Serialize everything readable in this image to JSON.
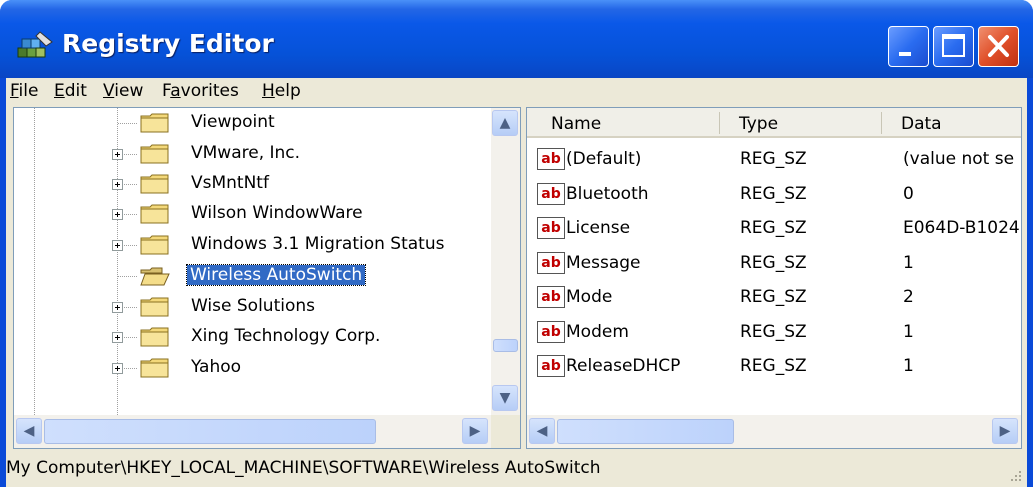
{
  "window": {
    "title": "Registry Editor",
    "title_color": "#ffffff",
    "titlebar_color": "#0a58e8"
  },
  "menu": [
    {
      "accel": "F",
      "rest": "ile"
    },
    {
      "accel": "E",
      "rest": "dit"
    },
    {
      "accel": "V",
      "rest": "iew"
    },
    {
      "pre": "F",
      "accel": "a",
      "rest": "vorites"
    },
    {
      "accel": "H",
      "rest": "elp"
    }
  ],
  "tree": {
    "items": [
      {
        "label": "Viewpoint",
        "expandable": false,
        "selected": false
      },
      {
        "label": "VMware, Inc.",
        "expandable": true,
        "selected": false
      },
      {
        "label": "VsMntNtf",
        "expandable": true,
        "selected": false
      },
      {
        "label": "Wilson WindowWare",
        "expandable": true,
        "selected": false
      },
      {
        "label": "Windows 3.1 Migration Status",
        "expandable": true,
        "selected": false
      },
      {
        "label": "Wireless AutoSwitch",
        "expandable": false,
        "selected": true
      },
      {
        "label": "Wise Solutions",
        "expandable": true,
        "selected": false
      },
      {
        "label": "Xing Technology Corp.",
        "expandable": true,
        "selected": false
      },
      {
        "label": "Yahoo",
        "expandable": true,
        "selected": false
      }
    ]
  },
  "values": {
    "columns": {
      "name": "Name",
      "type": "Type",
      "data": "Data"
    },
    "rows": [
      {
        "name": "(Default)",
        "type": "REG_SZ",
        "data": "(value not se"
      },
      {
        "name": "Bluetooth",
        "type": "REG_SZ",
        "data": "0"
      },
      {
        "name": "License",
        "type": "REG_SZ",
        "data": "E064D-B1024"
      },
      {
        "name": "Message",
        "type": "REG_SZ",
        "data": "1"
      },
      {
        "name": "Mode",
        "type": "REG_SZ",
        "data": "2"
      },
      {
        "name": "Modem",
        "type": "REG_SZ",
        "data": "1"
      },
      {
        "name": "ReleaseDHCP",
        "type": "REG_SZ",
        "data": "1"
      }
    ],
    "icon_text": "ab"
  },
  "status": {
    "path": "My Computer\\HKEY_LOCAL_MACHINE\\SOFTWARE\\Wireless AutoSwitch"
  },
  "colors": {
    "selection": "#316ac5",
    "frame": "#ece9d8"
  }
}
